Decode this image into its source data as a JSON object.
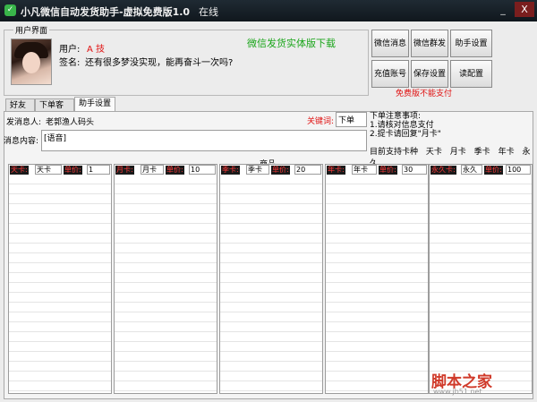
{
  "window": {
    "title": "小凡微信自动发货助手-虚拟免费版1.0",
    "status": "在线",
    "minimize": "_",
    "close": "X"
  },
  "user_panel": {
    "legend": "用户界面",
    "user_label": "用户:",
    "user_value": "A  技",
    "sign_label": "签名:",
    "sign_value": "还有很多梦没实现，能再奋斗一次吗?",
    "download_link": "微信发货实体版下载"
  },
  "buttons": {
    "wechat_msg": "微信消息",
    "wechat_group": "微信群发",
    "assist_settings": "助手设置",
    "recharge": "充值账号",
    "save_settings": "保存设置",
    "read_config": "读配置",
    "free_note": "免费版不能支付"
  },
  "tabs": [
    "好友",
    "下单客户",
    "助手设置"
  ],
  "settings": {
    "sender_label": "发消息人:",
    "sender_value": "老郭渔人码头",
    "keyword_label": "关键词:",
    "keyword_value": "下单",
    "content_label": "消息内容:",
    "content_value": "[语音]"
  },
  "notice": {
    "title": "下单注意事项:",
    "lines": [
      "1.请核对信息支付",
      "2.提卡请回复\"月卡\""
    ],
    "categories_label": "目前支持卡种",
    "categories": [
      "天卡",
      "月卡",
      "季卡",
      "年卡",
      "永久"
    ]
  },
  "goods": {
    "title": "商品",
    "columns": [
      {
        "chip1": "天卡:",
        "name": "天卡",
        "chip2": "单价:",
        "price": "1"
      },
      {
        "chip1": "月卡:",
        "name": "月卡",
        "chip2": "单价:",
        "price": "10"
      },
      {
        "chip1": "季卡:",
        "name": "季卡",
        "chip2": "单价:",
        "price": "20"
      },
      {
        "chip1": "年卡:",
        "name": "年卡",
        "chip2": "单价:",
        "price": "30"
      },
      {
        "chip1": "永久卡:",
        "name": "永久",
        "chip2": "单价:",
        "price": "100"
      }
    ]
  },
  "watermark": {
    "text": "脚本之家",
    "url": "www.jb51.net"
  }
}
